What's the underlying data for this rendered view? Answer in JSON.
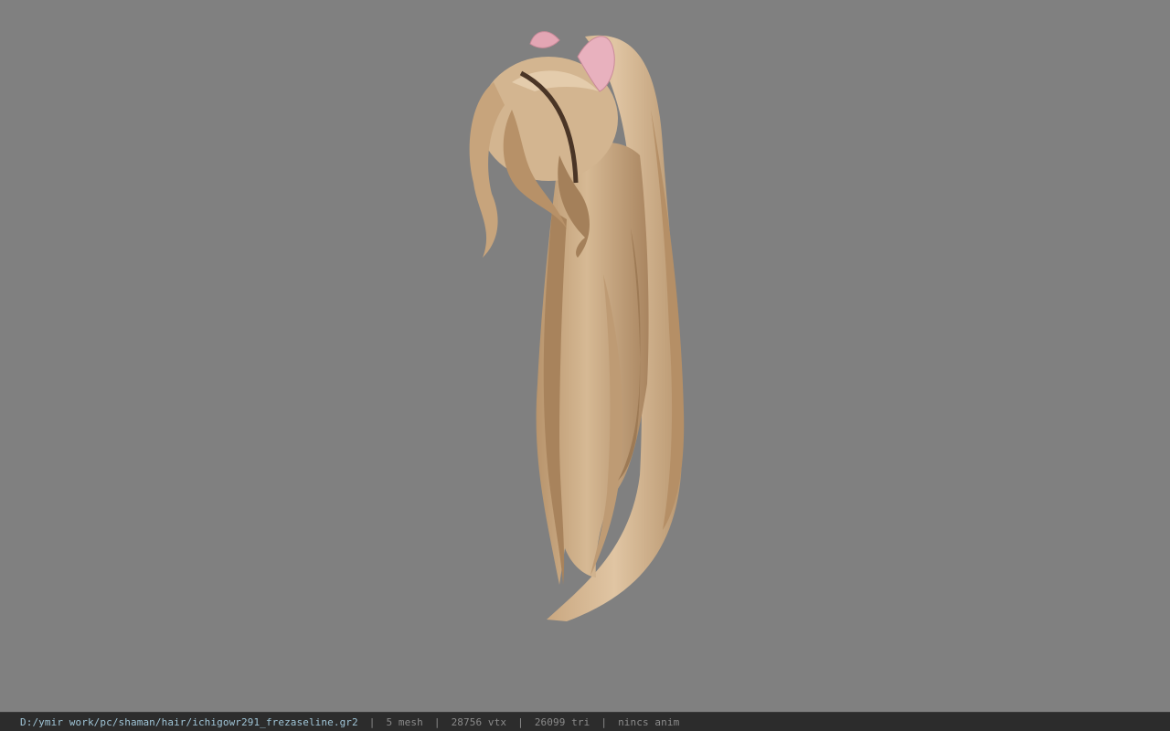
{
  "viewport": {
    "background_color": "#808080",
    "model": {
      "subject": "hair-model",
      "hair_color": "#c8a77f",
      "hair_shadow_color": "#8f6e4c",
      "accessory_color": "#e3a6b4"
    }
  },
  "statusbar": {
    "file_path": "D:/ymir work/pc/shaman/hair/ichigowr291_frezaseline.gr2",
    "separator": "|",
    "mesh_count": "5 mesh",
    "vertex_count": "28756 vtx",
    "triangle_count": "26099 tri",
    "anim_status": "nincs anim",
    "path_color": "#9fc4d6",
    "text_color": "#8a8a8a"
  }
}
